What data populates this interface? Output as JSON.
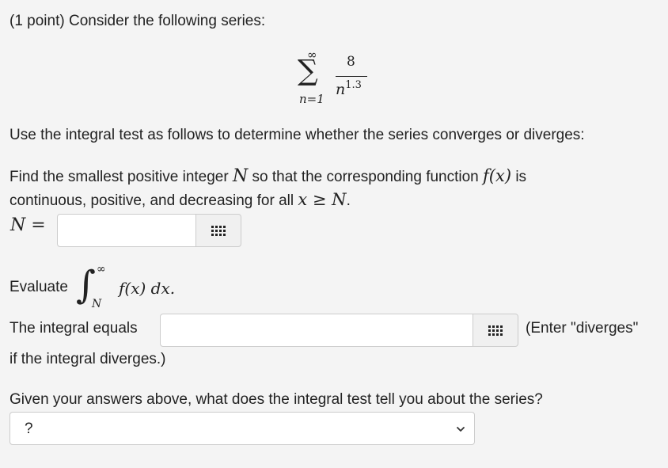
{
  "header": "(1 point) Consider the following series:",
  "series": {
    "upper": "∞",
    "sigma": "∑",
    "lower": "n=1",
    "numerator": "8",
    "denominator_base": "n",
    "denominator_exp": "1.3"
  },
  "instructions": "Use the integral test as follows to determine whether the series converges or diverges:",
  "find": {
    "line1_a": "Find the smallest positive integer ",
    "line1_var": "N",
    "line1_b": " so that the corresponding function ",
    "line1_func": "f(x)",
    "line1_c": " is",
    "line2_a": "continuous, positive, and decreasing for all ",
    "line2_math": "x ≥ N",
    "line2_b": "."
  },
  "n_input": {
    "label": "N =",
    "value": ""
  },
  "evaluate": {
    "label": "Evaluate",
    "int_sign": "∫",
    "upper": "∞",
    "lower": "N",
    "body": "f(x) dx."
  },
  "integral_input": {
    "label": "The integral equals",
    "value": "",
    "hint": "(Enter \"diverges\"",
    "hint_cont": "if the integral diverges.)"
  },
  "question": "Given your answers above, what does the integral test tell you about the series?",
  "select": {
    "value": "?"
  }
}
